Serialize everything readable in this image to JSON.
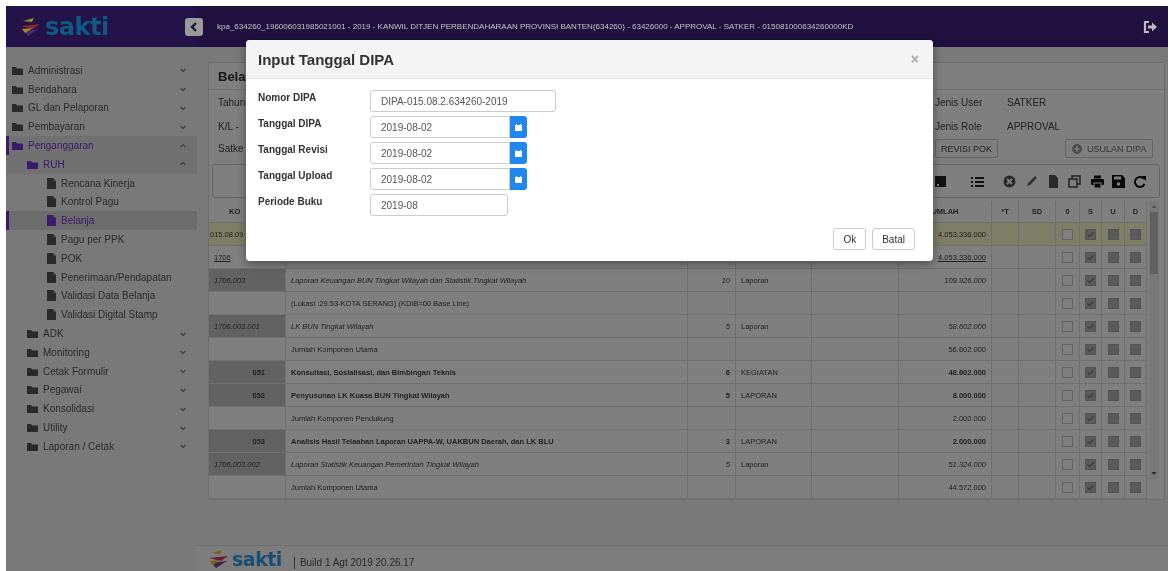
{
  "topbar": {
    "logo": "sakti",
    "title": "kpa_634260_196006031985021001 - 2019 - KANWIL DITJEN PERBENDAHARAAN PROVINSI BANTEN(634260) - 63426000 - APPROVAL - SATKER - 015081000634260000KD"
  },
  "sidebar": {
    "items": [
      {
        "kind": "folder",
        "label": "Administrasi",
        "expanded": false,
        "active": false
      },
      {
        "kind": "folder",
        "label": "Bendahara",
        "expanded": false,
        "active": false
      },
      {
        "kind": "folder",
        "label": "GL dan Pelaporan",
        "expanded": false,
        "active": false
      },
      {
        "kind": "folder",
        "label": "Pembayaran",
        "expanded": false,
        "active": false
      },
      {
        "kind": "folder",
        "label": "Penganggaran",
        "expanded": true,
        "active": true,
        "children": [
          {
            "kind": "folder",
            "label": "RUH",
            "expanded": true,
            "active": true,
            "children": [
              {
                "kind": "page",
                "label": "Rencana Kinerja",
                "selected": false
              },
              {
                "kind": "page",
                "label": "Kontrol Pagu",
                "selected": false
              },
              {
                "kind": "page",
                "label": "Belanja",
                "selected": true
              },
              {
                "kind": "page",
                "label": "Pagu per PPK",
                "selected": false
              },
              {
                "kind": "page",
                "label": "POK",
                "selected": false
              },
              {
                "kind": "page",
                "label": "Penerimaan/Pendapatan",
                "selected": false
              },
              {
                "kind": "page",
                "label": "Validasi Data Belanja",
                "selected": false
              },
              {
                "kind": "page",
                "label": "Validasi Digital Stamp",
                "selected": false
              }
            ]
          },
          {
            "kind": "folder",
            "label": "ADK",
            "expanded": false,
            "active": false
          },
          {
            "kind": "folder",
            "label": "Monitoring",
            "expanded": false,
            "active": false
          },
          {
            "kind": "folder",
            "label": "Cetak Formulir",
            "expanded": false,
            "active": false
          },
          {
            "kind": "folder",
            "label": "Pegawai",
            "expanded": false,
            "active": false
          },
          {
            "kind": "folder",
            "label": "Konsolidasi",
            "expanded": false,
            "active": false
          },
          {
            "kind": "folder",
            "label": "Utility",
            "expanded": false,
            "active": false
          },
          {
            "kind": "folder",
            "label": "Laporan / Cetak",
            "expanded": false,
            "active": false
          }
        ]
      }
    ]
  },
  "page": {
    "title": "Bela",
    "info_labels": [
      "Tahun",
      "K/L -",
      "Satke"
    ],
    "user_info": [
      {
        "label": "Jenis User",
        "value": "SATKER"
      },
      {
        "label": "Jenis Role",
        "value": "APPROVAL"
      }
    ],
    "buttons": [
      {
        "label": "REVISI POK",
        "disabled": false,
        "kind": "plain"
      },
      {
        "label": "USULAN DIPA",
        "disabled": true,
        "kind": "add"
      }
    ]
  },
  "table": {
    "columns": [
      {
        "kind": "kode",
        "label": "KO"
      },
      {
        "kind": "jumlah",
        "label": "UMLAH"
      },
      {
        "kind": "t",
        "label": "*T"
      },
      {
        "kind": "sd",
        "label": "SD"
      }
    ],
    "check_columns": [
      {
        "label": "0",
        "disabled": false
      },
      {
        "label": "S",
        "disabled": true
      },
      {
        "label": "U",
        "disabled": true
      },
      {
        "label": "D",
        "disabled": true
      }
    ],
    "rows": [
      {
        "kind": "unit",
        "selected": true,
        "kode": "015.08.09",
        "jumlah": "4.053.336.000",
        "checks": [
          false,
          true,
          false,
          false
        ]
      },
      {
        "kind": "program",
        "selected": false,
        "kode": "1706",
        "jumlah": "4.053.336.000",
        "checks": [
          false,
          true,
          false,
          false
        ]
      },
      {
        "kind": "output",
        "selected": false,
        "kode": "1706.003",
        "uraian": "Laporan Keuangan BUN Tingkat Wilayah dan Statistik Tingkat Wilayah",
        "volume": "10",
        "satuan": "Laporan",
        "jumlah": "109.926.000",
        "checks": [
          false,
          true,
          false,
          false
        ]
      },
      {
        "kind": "note",
        "selected": false,
        "uraian": "(Lokasi :29.53-KOTA SERANG) (KDIB=00 Base Line)",
        "checks": [
          false,
          true,
          false,
          false
        ]
      },
      {
        "kind": "output",
        "selected": false,
        "kode": "1706.003.001",
        "uraian": "LK BUN Tingkat Wilayah",
        "volume": "5",
        "satuan": "Laporan",
        "jumlah": "58.602.000",
        "checks": [
          false,
          true,
          false,
          false
        ]
      },
      {
        "kind": "note",
        "selected": false,
        "uraian": "Jumlah Komponen Utama",
        "jumlah": "56.602.000",
        "checks": [
          false,
          true,
          false,
          false
        ]
      },
      {
        "kind": "component",
        "selected": false,
        "kode": "051",
        "uraian": "Konsultasi, Sosialisasi, dan Bimbingan Teknis",
        "volume": "6",
        "satuan": "KEGIATAN",
        "jumlah": "48.602.000",
        "checks": [
          false,
          true,
          false,
          false
        ]
      },
      {
        "kind": "component",
        "selected": false,
        "kode": "052",
        "uraian": "Penyusunan LK Kuasa BUN Tingkat Wilayah",
        "volume": "5",
        "satuan": "LAPORAN",
        "jumlah": "8.000.000",
        "checks": [
          false,
          true,
          false,
          false
        ]
      },
      {
        "kind": "note",
        "selected": false,
        "uraian": "Jumlah Komponen Pendukung",
        "jumlah": "2.000.000",
        "checks": [
          false,
          true,
          false,
          false
        ]
      },
      {
        "kind": "component",
        "selected": false,
        "kode": "053",
        "uraian": "Analisis Hasil Telaahan Laporan UAPPA-W, UAKBUN Daerah, dan LK BLU",
        "volume": "3",
        "satuan": "LAPORAN",
        "jumlah": "2.000.000",
        "checks": [
          false,
          true,
          false,
          false
        ]
      },
      {
        "kind": "output",
        "selected": false,
        "kode": "1706.003.002",
        "uraian": "Laporan Statistik Keuangan Pemerintah Tingkat Wilayah",
        "volume": "5",
        "satuan": "Laporan",
        "jumlah": "51.324.000",
        "checks": [
          false,
          true,
          false,
          false
        ]
      },
      {
        "kind": "note",
        "selected": false,
        "uraian": "Jumlah Komponen Utama",
        "jumlah": "44.572.000",
        "checks": [
          false,
          true,
          false,
          false
        ]
      }
    ]
  },
  "footer": {
    "logo": "sakti",
    "build": "Build 1 Agt 2019 20.26.17"
  },
  "modal": {
    "title": "Input Tanggal DIPA",
    "close": "×",
    "fields": [
      {
        "kind": "text",
        "label": "Nomor DIPA",
        "value": "DIPA-015.08.2.634260-2019"
      },
      {
        "kind": "date",
        "label": "Tanggal DIPA",
        "value": "2019-08-02"
      },
      {
        "kind": "date",
        "label": "Tanggal Revisi",
        "value": "2019-08-02"
      },
      {
        "kind": "date",
        "label": "Tanggal Upload",
        "value": "2019-08-02"
      },
      {
        "kind": "short",
        "label": "Periode Buku",
        "value": "2019-08"
      }
    ],
    "buttons": [
      "Ok",
      "Batal"
    ]
  }
}
